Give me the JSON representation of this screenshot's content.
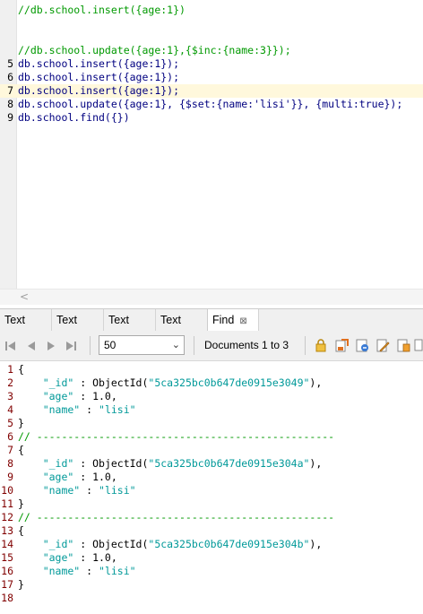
{
  "editor": {
    "lines": [
      {
        "num": "",
        "text": "//db.school.insert({age:1})",
        "kind": "comment"
      },
      {
        "num": "",
        "text": "",
        "kind": "code"
      },
      {
        "num": "",
        "text": "",
        "kind": "code"
      },
      {
        "num": "",
        "text": "//db.school.update({age:1},{$inc:{name:3}});",
        "kind": "comment"
      },
      {
        "num": "5",
        "text": "db.school.insert({age:1});",
        "kind": "code"
      },
      {
        "num": "6",
        "text": "db.school.insert({age:1});",
        "kind": "code"
      },
      {
        "num": "7",
        "text": "db.school.insert({age:1});",
        "kind": "code"
      },
      {
        "num": "8",
        "text": "db.school.update({age:1}, {$set:{name:'lisi'}}, {multi:true});",
        "kind": "code"
      },
      {
        "num": "9",
        "text": "db.school.find({})",
        "kind": "code"
      }
    ],
    "scroll_arrow": "<"
  },
  "tabs": [
    {
      "label": "Text"
    },
    {
      "label": "Text"
    },
    {
      "label": "Text"
    },
    {
      "label": "Text"
    },
    {
      "label": "Find",
      "close": "⊠"
    }
  ],
  "toolbar": {
    "page_size": "50",
    "documents_label": "Documents 1 to 3"
  },
  "results": {
    "lines": [
      {
        "num": "1",
        "segs": [
          {
            "t": "{",
            "c": "p"
          }
        ]
      },
      {
        "num": "2",
        "segs": [
          {
            "t": "    \"_id\"",
            "c": "s"
          },
          {
            "t": " : ",
            "c": "p"
          },
          {
            "t": "ObjectId(",
            "c": "p"
          },
          {
            "t": "\"5ca325bc0b647de0915e3049\"",
            "c": "s"
          },
          {
            "t": "),",
            "c": "p"
          }
        ]
      },
      {
        "num": "3",
        "segs": [
          {
            "t": "    \"age\"",
            "c": "s"
          },
          {
            "t": " : 1.0,",
            "c": "p"
          }
        ]
      },
      {
        "num": "4",
        "segs": [
          {
            "t": "    \"name\"",
            "c": "s"
          },
          {
            "t": " : ",
            "c": "p"
          },
          {
            "t": "\"lisi\"",
            "c": "s"
          }
        ]
      },
      {
        "num": "5",
        "segs": [
          {
            "t": "}",
            "c": "p"
          }
        ]
      },
      {
        "num": "6",
        "segs": [
          {
            "t": "// ------------------------------------------------",
            "c": "sepline"
          }
        ]
      },
      {
        "num": "7",
        "segs": [
          {
            "t": "{",
            "c": "p"
          }
        ]
      },
      {
        "num": "8",
        "segs": [
          {
            "t": "    \"_id\"",
            "c": "s"
          },
          {
            "t": " : ",
            "c": "p"
          },
          {
            "t": "ObjectId(",
            "c": "p"
          },
          {
            "t": "\"5ca325bc0b647de0915e304a\"",
            "c": "s"
          },
          {
            "t": "),",
            "c": "p"
          }
        ]
      },
      {
        "num": "9",
        "segs": [
          {
            "t": "    \"age\"",
            "c": "s"
          },
          {
            "t": " : 1.0,",
            "c": "p"
          }
        ]
      },
      {
        "num": "10",
        "segs": [
          {
            "t": "    \"name\"",
            "c": "s"
          },
          {
            "t": " : ",
            "c": "p"
          },
          {
            "t": "\"lisi\"",
            "c": "s"
          }
        ]
      },
      {
        "num": "11",
        "segs": [
          {
            "t": "}",
            "c": "p"
          }
        ]
      },
      {
        "num": "12",
        "segs": [
          {
            "t": "// ------------------------------------------------",
            "c": "sepline"
          }
        ]
      },
      {
        "num": "13",
        "segs": [
          {
            "t": "{",
            "c": "p"
          }
        ]
      },
      {
        "num": "14",
        "segs": [
          {
            "t": "    \"_id\"",
            "c": "s"
          },
          {
            "t": " : ",
            "c": "p"
          },
          {
            "t": "ObjectId(",
            "c": "p"
          },
          {
            "t": "\"5ca325bc0b647de0915e304b\"",
            "c": "s"
          },
          {
            "t": "),",
            "c": "p"
          }
        ]
      },
      {
        "num": "15",
        "segs": [
          {
            "t": "    \"age\"",
            "c": "s"
          },
          {
            "t": " : 1.0,",
            "c": "p"
          }
        ]
      },
      {
        "num": "16",
        "segs": [
          {
            "t": "    \"name\"",
            "c": "s"
          },
          {
            "t": " : ",
            "c": "p"
          },
          {
            "t": "\"lisi\"",
            "c": "s"
          }
        ]
      },
      {
        "num": "17",
        "segs": [
          {
            "t": "}",
            "c": "p"
          }
        ]
      },
      {
        "num": "18",
        "segs": []
      }
    ]
  },
  "colors": {
    "comment": "#009900",
    "code": "#000080",
    "string": "#009999",
    "line_number": "#800000",
    "current_line": "#fff8dc"
  },
  "icons": [
    "first-page-icon",
    "prev-page-icon",
    "next-page-icon",
    "last-page-icon",
    "lock-icon",
    "export-icon",
    "import-icon",
    "edit-icon",
    "view-icon",
    "grid-icon"
  ]
}
